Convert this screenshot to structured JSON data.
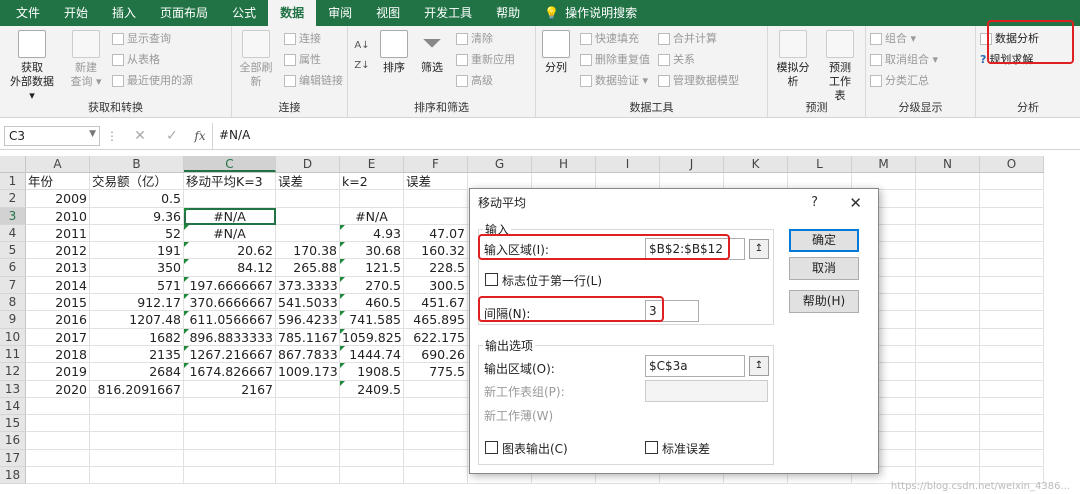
{
  "ribbon_tabs": [
    "文件",
    "开始",
    "插入",
    "页面布局",
    "公式",
    "数据",
    "审阅",
    "视图",
    "开发工具",
    "帮助",
    "操作说明搜索"
  ],
  "active_tab": "数据",
  "groups": {
    "get_transform": {
      "label": "获取和转换",
      "big1_l1": "获取",
      "big1_l2": "外部数据 ▾",
      "big2_l1": "新建",
      "big2_l2": "查询 ▾",
      "small": [
        "显示查询",
        "从表格",
        "最近使用的源"
      ]
    },
    "connections": {
      "label": "连接",
      "big_l1": "全部刷新",
      "small": [
        "连接",
        "属性",
        "编辑链接"
      ]
    },
    "sort_filter": {
      "label": "排序和筛选",
      "sort": "排序",
      "filter": "筛选",
      "small": [
        "清除",
        "重新应用",
        "高级"
      ]
    },
    "data_tools": {
      "label": "数据工具",
      "split": "分列",
      "small": [
        "快速填充",
        "删除重复值",
        "数据验证 ▾",
        "合并计算",
        "关系",
        "管理数据模型"
      ]
    },
    "forecast": {
      "label": "预测",
      "whatif_l1": "模拟分析",
      "forecast_l1": "预测",
      "forecast_l2": "工作表"
    },
    "outline": {
      "label": "分级显示",
      "small": [
        "组合 ▾",
        "取消组合 ▾",
        "分类汇总"
      ]
    },
    "analysis": {
      "label": "分析",
      "small": [
        "数据分析",
        "规划求解"
      ]
    }
  },
  "formula_bar": {
    "name_box": "C3",
    "formula": "#N/A",
    "fx": "fx",
    "cancel": "✕",
    "enter": "✓"
  },
  "columns": [
    "A",
    "B",
    "C",
    "D",
    "E",
    "F",
    "G",
    "H",
    "I",
    "J",
    "K",
    "L",
    "M",
    "N",
    "O"
  ],
  "rows": [
    {
      "n": "1",
      "A": "年份",
      "B": "交易额（亿）",
      "C": "移动平均K=3",
      "D": "误差",
      "E": "k=2",
      "F": "误差"
    },
    {
      "n": "2",
      "A": "2009",
      "B": "0.5",
      "C": "",
      "D": "",
      "E": "",
      "F": ""
    },
    {
      "n": "3",
      "A": "2010",
      "B": "9.36",
      "C": "#N/A",
      "D": "",
      "E": "#N/A",
      "F": ""
    },
    {
      "n": "4",
      "A": "2011",
      "B": "52",
      "C": "#N/A",
      "D": "",
      "E": "4.93",
      "F": "47.07"
    },
    {
      "n": "5",
      "A": "2012",
      "B": "191",
      "C": "20.62",
      "D": "170.38",
      "E": "30.68",
      "F": "160.32"
    },
    {
      "n": "6",
      "A": "2013",
      "B": "350",
      "C": "84.12",
      "D": "265.88",
      "E": "121.5",
      "F": "228.5"
    },
    {
      "n": "7",
      "A": "2014",
      "B": "571",
      "C": "197.6666667",
      "D": "373.3333",
      "E": "270.5",
      "F": "300.5"
    },
    {
      "n": "8",
      "A": "2015",
      "B": "912.17",
      "C": "370.6666667",
      "D": "541.5033",
      "E": "460.5",
      "F": "451.67"
    },
    {
      "n": "9",
      "A": "2016",
      "B": "1207.48",
      "C": "611.0566667",
      "D": "596.4233",
      "E": "741.585",
      "F": "465.895"
    },
    {
      "n": "10",
      "A": "2017",
      "B": "1682",
      "C": "896.8833333",
      "D": "785.1167",
      "E": "1059.825",
      "F": "622.175"
    },
    {
      "n": "11",
      "A": "2018",
      "B": "2135",
      "C": "1267.216667",
      "D": "867.7833",
      "E": "1444.74",
      "F": "690.26"
    },
    {
      "n": "12",
      "A": "2019",
      "B": "2684",
      "C": "1674.826667",
      "D": "1009.173",
      "E": "1908.5",
      "F": "775.5"
    },
    {
      "n": "13",
      "A": "2020",
      "B": "816.2091667",
      "C": "2167",
      "D": "",
      "E": "2409.5",
      "F": ""
    },
    {
      "n": "14",
      "A": "",
      "B": "",
      "C": "",
      "D": "",
      "E": "",
      "F": ""
    },
    {
      "n": "15",
      "A": "",
      "B": "",
      "C": "",
      "D": "",
      "E": "",
      "F": ""
    },
    {
      "n": "16",
      "A": "",
      "B": "",
      "C": "",
      "D": "",
      "E": "",
      "F": ""
    },
    {
      "n": "17",
      "A": "",
      "B": "",
      "C": "",
      "D": "",
      "E": "",
      "F": ""
    },
    {
      "n": "18",
      "A": "",
      "B": "",
      "C": "",
      "D": "",
      "E": "",
      "F": ""
    }
  ],
  "dialog": {
    "title": "移动平均",
    "help": "?",
    "close": "✕",
    "input_section": "输入",
    "input_range_label": "输入区域(I):",
    "input_range_value": "$B$2:$B$12",
    "labels_first_row": "标志位于第一行(L)",
    "interval_label": "间隔(N):",
    "interval_value": "3",
    "output_section": "输出选项",
    "output_range_label": "输出区域(O):",
    "output_range_value": "$C$3a",
    "new_sheet_label": "新工作表组(P):",
    "new_workbook_label": "新工作薄(W)",
    "chart_output": "图表输出(C)",
    "std_error": "标准误差",
    "ok": "确定",
    "cancel": "取消",
    "help_btn": "帮助(H)",
    "ref_icon": "↥"
  },
  "watermark": "https://blog.csdn.net/weixin_4386...",
  "accent_color": "#217346",
  "highlight_color": "#e02020"
}
